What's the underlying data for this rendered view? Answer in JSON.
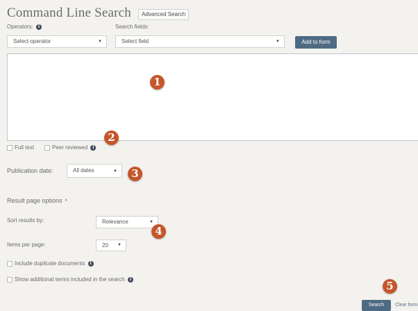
{
  "header": {
    "title": "Command Line Search",
    "advanced_label": "Advanced Search"
  },
  "operators": {
    "label": "Operators:",
    "select_value": "Select operator"
  },
  "fields": {
    "label": "Search fields:",
    "select_value": "Select field"
  },
  "add_button": "Add to form",
  "filters": {
    "fulltext": "Full text",
    "peer_reviewed": "Peer reviewed"
  },
  "publication": {
    "label": "Publication date:",
    "value": "All dates"
  },
  "result_options": {
    "heading": "Result page options",
    "sort_label": "Sort results by:",
    "sort_value": "Relevance",
    "per_page_label": "Items per page:",
    "per_page_value": "20",
    "include_duplicates": "Include duplicate documents",
    "show_additional": "Show additional terms included in the search"
  },
  "actions": {
    "search": "Search",
    "clear": "Clear form"
  },
  "callouts": [
    "1",
    "2",
    "3",
    "4",
    "5"
  ],
  "colors": {
    "accent_button": "#4f6a83",
    "callout": "#c5562b",
    "background": "#f3f2ef"
  },
  "icons": {
    "info": "info-icon",
    "dropdown": "chevron-down-icon",
    "collapse": "chevron-up-icon"
  }
}
